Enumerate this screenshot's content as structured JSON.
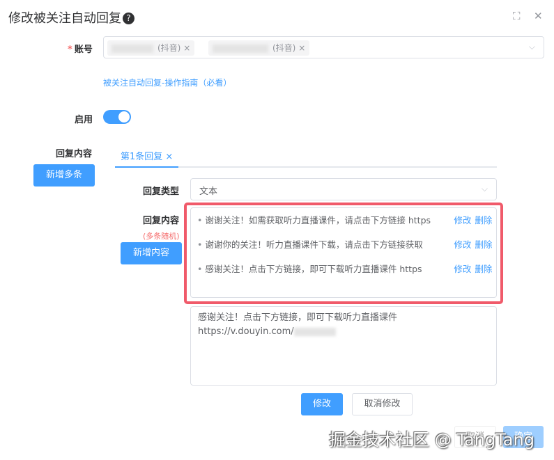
{
  "dialog": {
    "title": "修改被关注自动回复",
    "help_icon": "?",
    "fullscreen_icon": "⛶",
    "close_icon": "✕"
  },
  "account": {
    "label": "账号",
    "required": "*",
    "tags": [
      {
        "suffix": "(抖音)"
      },
      {
        "suffix": "(抖音)"
      }
    ],
    "guide_link": "被关注自动回复-操作指南（必看）"
  },
  "enable": {
    "label": "启用",
    "value": true
  },
  "reply": {
    "label": "回复内容",
    "add_many": "新增多条",
    "tab": "第1条回复",
    "type_label": "回复类型",
    "type_value": "文本",
    "content_label": "回复内容",
    "content_note": "(多条随机)",
    "add_content": "新增内容",
    "items": [
      {
        "text": "谢谢关注！如需获取听力直播课件，请点击下方链接 https",
        "edit": "修改",
        "del": "删除"
      },
      {
        "text": "谢谢你的关注！听力直播课件下载，请点击下方链接获取",
        "edit": "修改",
        "del": "删除"
      },
      {
        "text": "感谢关注！点击下方链接，即可下载听力直播课件 https",
        "edit": "修改",
        "del": "删除"
      }
    ],
    "editor_line1": "感谢关注！点击下方链接，即可下载听力直播课件",
    "editor_line2": "https://v.douyin.com/",
    "modify": "修改",
    "cancel_modify": "取消修改"
  },
  "footer": {
    "cancel": "取消",
    "confirm": "确定"
  },
  "watermark": "掘金技术社区 @ TangTang"
}
